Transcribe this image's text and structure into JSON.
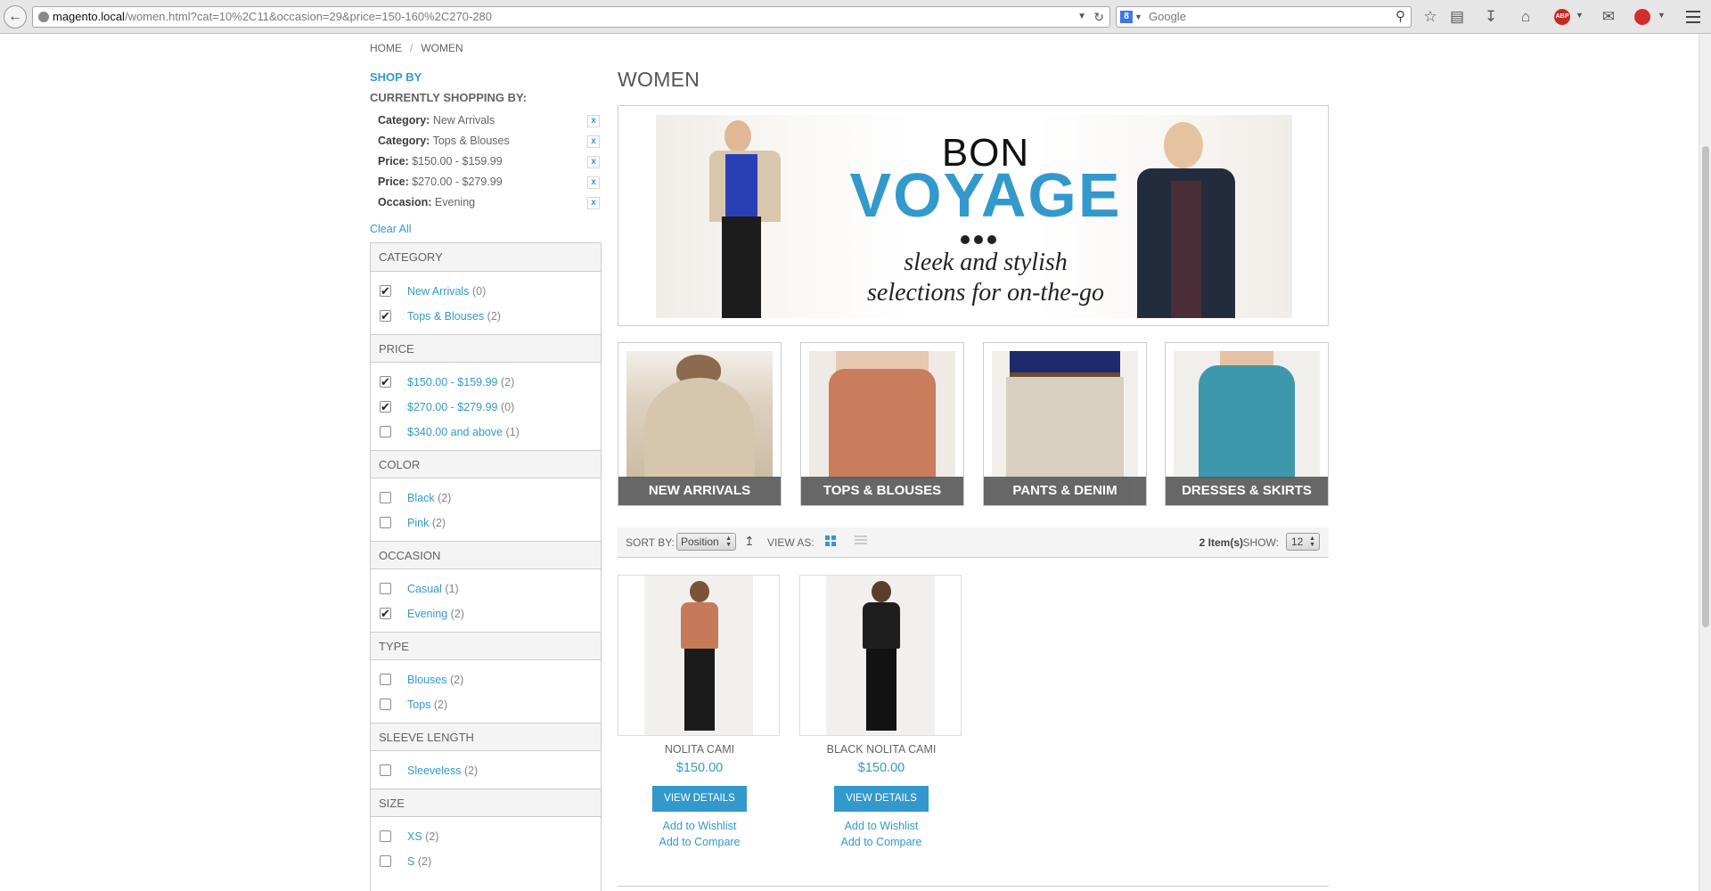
{
  "browser": {
    "url_host": "magento.local",
    "url_path": "/women.html?cat=10%2C11&occasion=29&price=150-160%2C270-280",
    "search_placeholder": "Google"
  },
  "breadcrumb": [
    "HOME",
    "/",
    "WOMEN"
  ],
  "sidebar": {
    "shop_by": "SHOP BY",
    "currently_label": "CURRENTLY SHOPPING BY:",
    "active_filters": [
      {
        "label": "Category:",
        "value": "New Arrivals",
        "remove": "x"
      },
      {
        "label": "Category:",
        "value": "Tops & Blouses",
        "remove": "x"
      },
      {
        "label": "Price:",
        "value": "$150.00 - $159.99",
        "remove": "x"
      },
      {
        "label": "Price:",
        "value": "$270.00 - $279.99",
        "remove": "x"
      },
      {
        "label": "Occasion:",
        "value": "Evening",
        "remove": "x"
      }
    ],
    "clear_all": "Clear All",
    "filter_groups": [
      {
        "title": "CATEGORY",
        "options": [
          {
            "label": "New Arrivals",
            "count": "(0)",
            "checked": true
          },
          {
            "label": "Tops & Blouses",
            "count": "(2)",
            "checked": true
          }
        ]
      },
      {
        "title": "PRICE",
        "options": [
          {
            "label": "$150.00 - $159.99",
            "count": "(2)",
            "checked": true
          },
          {
            "label": "$270.00 - $279.99",
            "count": "(0)",
            "checked": true
          },
          {
            "label": "$340.00 and above",
            "count": "(1)",
            "checked": false
          }
        ]
      },
      {
        "title": "COLOR",
        "options": [
          {
            "label": "Black",
            "count": "(2)",
            "checked": false
          },
          {
            "label": "Pink",
            "count": "(2)",
            "checked": false
          }
        ]
      },
      {
        "title": "OCCASION",
        "options": [
          {
            "label": "Casual",
            "count": "(1)",
            "checked": false
          },
          {
            "label": "Evening",
            "count": "(2)",
            "checked": true
          }
        ]
      },
      {
        "title": "TYPE",
        "options": [
          {
            "label": "Blouses",
            "count": "(2)",
            "checked": false
          },
          {
            "label": "Tops",
            "count": "(2)",
            "checked": false
          }
        ]
      },
      {
        "title": "SLEEVE LENGTH",
        "options": [
          {
            "label": "Sleeveless",
            "count": "(2)",
            "checked": false
          }
        ]
      },
      {
        "title": "SIZE",
        "options": [
          {
            "label": "XS",
            "count": "(2)",
            "checked": false
          },
          {
            "label": "S",
            "count": "(2)",
            "checked": false
          }
        ]
      }
    ]
  },
  "main": {
    "title": "WOMEN",
    "hero": {
      "line1": "BON",
      "line2": "VOYAGE",
      "tagline1": "sleek and stylish",
      "tagline2": "selections for on-the-go"
    },
    "categories": [
      {
        "label": "NEW ARRIVALS"
      },
      {
        "label": "TOPS & BLOUSES"
      },
      {
        "label": "PANTS & DENIM"
      },
      {
        "label": "DRESSES & SKIRTS"
      }
    ],
    "toolbar": {
      "sort_label": "SORT BY:",
      "sort_value": "Position",
      "view_label": "VIEW AS:",
      "items_count": "2 Item(s)",
      "show_label": "SHOW:",
      "show_value": "12"
    },
    "products": [
      {
        "name": "NOLITA CAMI",
        "price": "$150.00",
        "button": "VIEW DETAILS",
        "wishlist": "Add to Wishlist",
        "compare": "Add to Compare",
        "top_color": "#c77a5a"
      },
      {
        "name": "BLACK NOLITA CAMI",
        "price": "$150.00",
        "button": "VIEW DETAILS",
        "wishlist": "Add to Wishlist",
        "compare": "Add to Compare",
        "top_color": "#1e1e1e"
      }
    ]
  },
  "colors": {
    "accent": "#3399cc",
    "text": "#636363",
    "panel_bg": "#f4f4f4"
  },
  "icons": [
    "back-arrow-icon",
    "globe-icon",
    "reload-icon",
    "search-icon",
    "star-icon",
    "bookmarks-icon",
    "download-icon",
    "home-icon",
    "adblock-icon",
    "mail-icon",
    "menu-icon",
    "sort-direction-icon",
    "grid-view-icon",
    "list-view-icon"
  ]
}
